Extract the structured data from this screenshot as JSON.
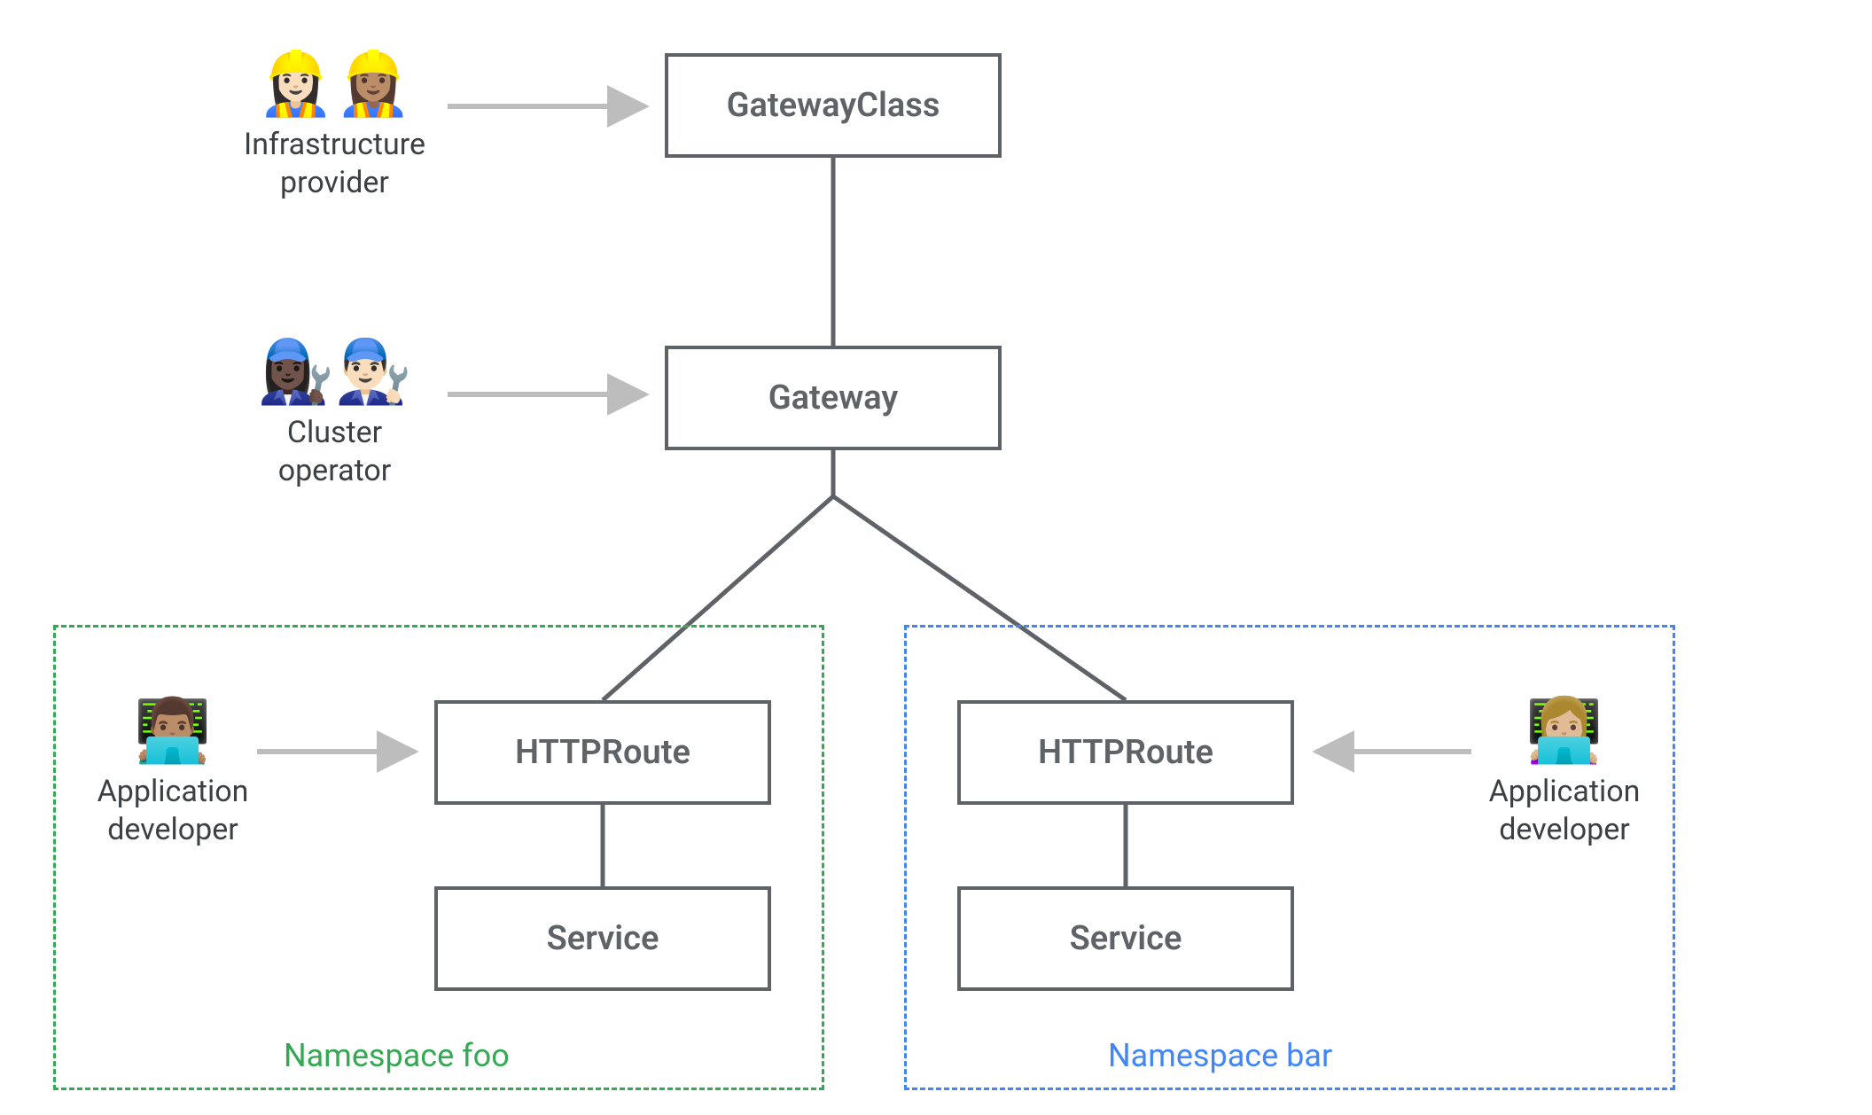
{
  "nodes": {
    "gatewayclass": "GatewayClass",
    "gateway": "Gateway",
    "httproute_foo": "HTTPRoute",
    "service_foo": "Service",
    "httproute_bar": "HTTPRoute",
    "service_bar": "Service"
  },
  "namespaces": {
    "foo": {
      "label": "Namespace foo",
      "color": "#34a853"
    },
    "bar": {
      "label": "Namespace bar",
      "color": "#4285f4"
    }
  },
  "personas": {
    "infra": {
      "label_line1": "Infrastructure",
      "label_line2": "provider",
      "emoji": "👷🏻‍♀️👷🏽‍♀️"
    },
    "cluster": {
      "label_line1": "Cluster",
      "label_line2": "operator",
      "emoji": "👩🏿‍🔧👨🏻‍🔧"
    },
    "appdev_left": {
      "label_line1": "Application",
      "label_line2": "developer",
      "emoji": "👨🏽‍💻"
    },
    "appdev_right": {
      "label_line1": "Application",
      "label_line2": "developer",
      "emoji": "👩🏼‍💻"
    }
  },
  "colors": {
    "box_border": "#5f6368",
    "text": "#5f6368",
    "arrow": "#bdbdbd",
    "line": "#5f6368",
    "ns_foo": "#34a853",
    "ns_bar": "#4285f4"
  }
}
